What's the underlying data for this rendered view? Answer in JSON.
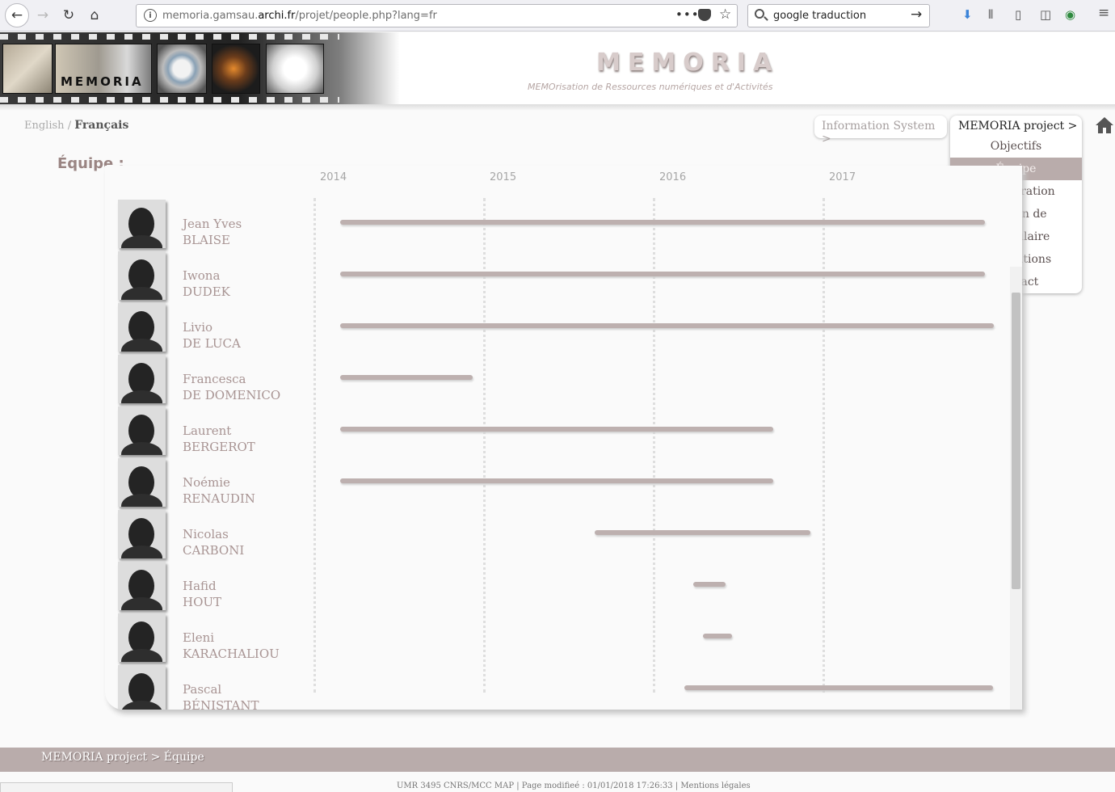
{
  "browser": {
    "url_prefix": "memoria.gamsau.",
    "url_domain": "archi.fr",
    "url_path": "/projet/people.php?lang=fr",
    "search_value": "google traduction"
  },
  "header": {
    "logo_text": "MEMORIA",
    "site_title": "MEMORIA",
    "site_subtitle": "MEMOrisation de Ressources numériques et d'Activités"
  },
  "lang": {
    "english": "English",
    "separator": "/",
    "francais": "Français"
  },
  "nav": {
    "information_system": "Information System  >",
    "project": "MEMORIA project  >",
    "items": [
      "Objectifs",
      "Équipe",
      "Collaboration",
      "Soutien de",
      "Vocabulaire",
      "Publications",
      "Contact"
    ],
    "selected": "Équipe"
  },
  "page_title": "Équipe :",
  "chart_data": {
    "type": "timeline",
    "x_ticks": [
      "2014",
      "2015",
      "2016",
      "2017"
    ],
    "xlim": [
      2013.95,
      2017.9
    ],
    "people": [
      {
        "first": "Jean Yves",
        "last": "BLAISE",
        "start": 2014.1,
        "end": 2017.9
      },
      {
        "first": "Iwona",
        "last": "DUDEK",
        "start": 2014.1,
        "end": 2017.9
      },
      {
        "first": "Livio",
        "last": "DE LUCA",
        "start": 2014.1,
        "end": 2017.95
      },
      {
        "first": "Francesca",
        "last": "DE DOMENICO",
        "start": 2014.1,
        "end": 2014.88
      },
      {
        "first": "Laurent",
        "last": "BERGEROT",
        "start": 2014.1,
        "end": 2016.65
      },
      {
        "first": "Noémie",
        "last": "RENAUDIN",
        "start": 2014.1,
        "end": 2016.65
      },
      {
        "first": "Nicolas",
        "last": "CARBONI",
        "start": 2015.6,
        "end": 2016.87
      },
      {
        "first": "Hafid",
        "last": "HOUT",
        "start": 2016.18,
        "end": 2016.37
      },
      {
        "first": "Eleni",
        "last": "KARACHALIOU",
        "start": 2016.24,
        "end": 2016.41
      },
      {
        "first": "Pascal",
        "last": "BÉNISTANT",
        "start": 2016.13,
        "end": 2017.95
      }
    ]
  },
  "footer": {
    "crumb": "MEMORIA  project  >  Équipe",
    "info": "UMR 3495 CNRS/MCC MAP   |   Page modifieé : 01/01/2018 17:26:33   |   Mentions légales"
  }
}
